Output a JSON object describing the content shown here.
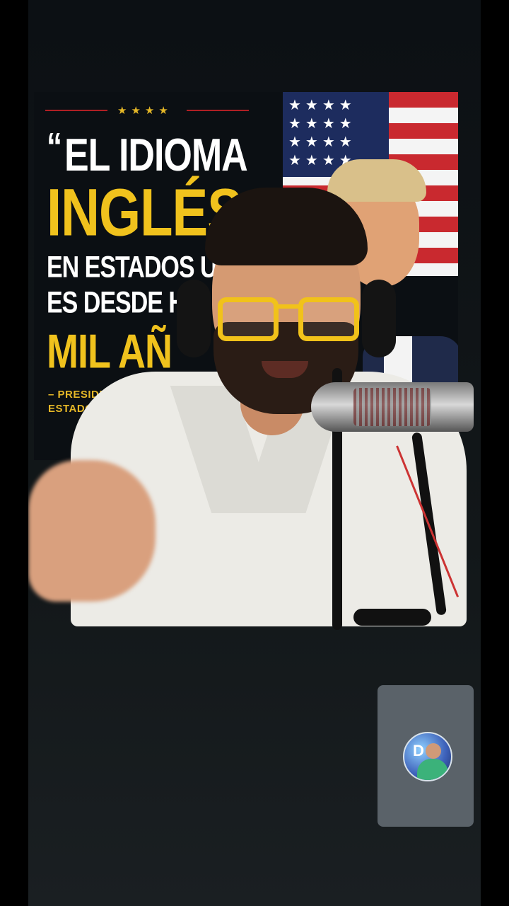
{
  "poster": {
    "stars": "★★★★",
    "quote_mark": "“",
    "line1": "EL IDIOMA",
    "line2": "INGLÉS",
    "line3": "EN ESTADOS UN",
    "line4": "ES DESDE H",
    "line5": "MIL AÑ",
    "attribution_1": "– PRESIDENTE DE",
    "attribution_2": "ESTADO"
  },
  "pip": {
    "avatar_letter": "D"
  },
  "colors": {
    "accent_yellow": "#f0c21d",
    "rule_red": "#b01f24",
    "pip_bg": "#5a6269"
  }
}
